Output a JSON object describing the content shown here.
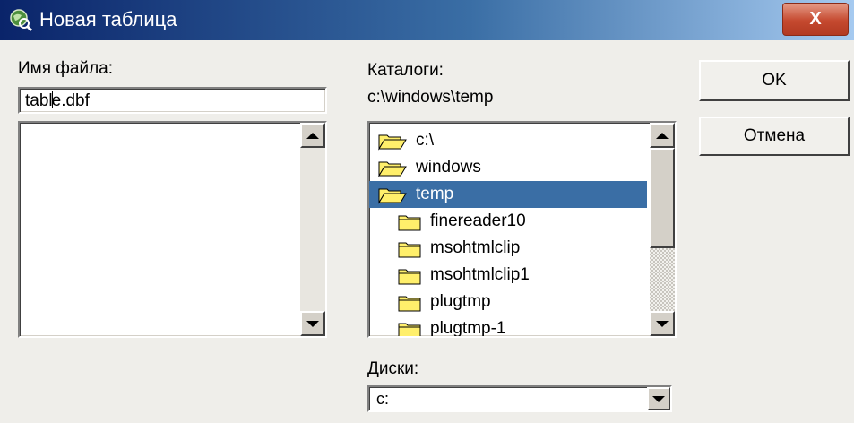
{
  "window": {
    "title": "Новая таблица",
    "close_label": "X"
  },
  "file": {
    "label": "Имя файла:",
    "name_before_caret": "tabl",
    "name_after_caret": "e.dbf"
  },
  "dirs": {
    "label": "Каталоги:",
    "path": "c:\\windows\\temp",
    "items": [
      {
        "label": "c:\\",
        "icon": "open-folder-icon"
      },
      {
        "label": "windows",
        "icon": "open-folder-icon"
      },
      {
        "label": "temp",
        "icon": "open-folder-icon",
        "selected": true
      },
      {
        "label": "finereader10",
        "icon": "folder-icon"
      },
      {
        "label": "msohtmlclip",
        "icon": "folder-icon"
      },
      {
        "label": "msohtmlclip1",
        "icon": "folder-icon"
      },
      {
        "label": "plugtmp",
        "icon": "folder-icon"
      },
      {
        "label": "plugtmp-1",
        "icon": "folder-icon"
      }
    ]
  },
  "drives": {
    "label": "Диски:",
    "value": "c:"
  },
  "buttons": {
    "ok": "OK",
    "cancel": "Отмена"
  },
  "colors": {
    "selection": "#3a6ea5",
    "folder": "#ffef6b",
    "close": "#c5492f"
  }
}
